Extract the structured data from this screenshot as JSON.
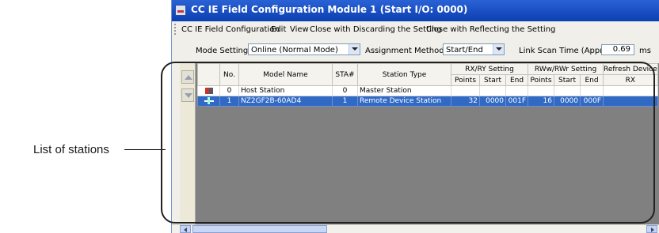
{
  "callout": {
    "label": "List of stations"
  },
  "window": {
    "title": "CC IE Field Configuration Module 1 (Start I/O: 0000)"
  },
  "menu": {
    "items": [
      "CC IE Field Configuration",
      "Edit",
      "View",
      "Close with Discarding the Setting",
      "Close with Reflecting the Setting"
    ]
  },
  "settings": {
    "mode_label": "Mode Setting:",
    "mode_value": "Online (Normal Mode)",
    "assign_label": "Assignment Method:",
    "assign_value": "Start/End",
    "scan_label": "Link Scan Time (Approx.):",
    "scan_value": "0.69",
    "scan_unit": "ms"
  },
  "table": {
    "headers": {
      "no": "No.",
      "model": "Model Name",
      "sta": "STA#",
      "type": "Station Type",
      "rxry": "RX/RY Setting",
      "rwwrwr": "RWw/RWr Setting",
      "refresh": "Refresh Device",
      "points": "Points",
      "start": "Start",
      "end": "End",
      "rx": "RX"
    },
    "rows": [
      {
        "icon": "master-station-icon",
        "no": "0",
        "model": "Host Station",
        "sta": "0",
        "type": "Master Station",
        "rx_points": "",
        "rx_start": "",
        "rx_end": "",
        "rw_points": "",
        "rw_start": "",
        "rw_end": "",
        "refresh": ""
      },
      {
        "icon": "remote-station-icon",
        "no": "1",
        "model": "NZ2GF2B-60AD4",
        "sta": "1",
        "type": "Remote Device Station",
        "rx_points": "32",
        "rx_start": "0000",
        "rx_end": "001F",
        "rw_points": "16",
        "rw_start": "0000",
        "rw_end": "000F",
        "refresh": ""
      }
    ]
  },
  "colors": {
    "titlebar": "#0b3fb2",
    "selection": "#316ac5",
    "grid_background": "#808080"
  }
}
